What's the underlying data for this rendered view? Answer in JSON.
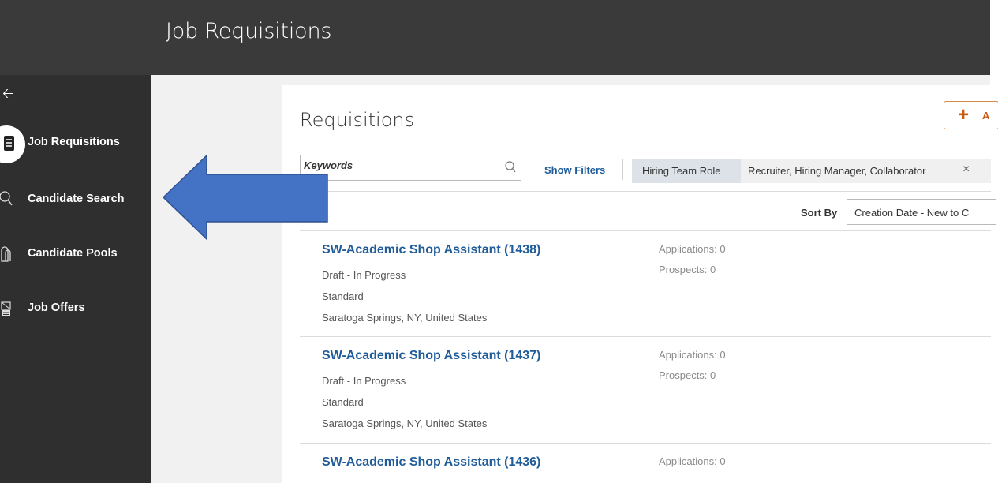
{
  "header": {
    "title": "Job Requisitions"
  },
  "sidebar": {
    "items": [
      {
        "label": "Job Requisitions",
        "icon": "document-list-icon",
        "active": true
      },
      {
        "label": "Candidate Search",
        "icon": "search-icon"
      },
      {
        "label": "Candidate Pools",
        "icon": "pool-icon"
      },
      {
        "label": "Job Offers",
        "icon": "offer-letter-icon"
      }
    ]
  },
  "main": {
    "title": "Requisitions",
    "add_button_label": "A",
    "search": {
      "placeholder": "Keywords"
    },
    "show_filters": "Show Filters",
    "filter": {
      "role": "Hiring Team Role",
      "values": "Recruiter, Hiring Manager, Collaborator",
      "remove": "×"
    },
    "sort": {
      "label": "Sort By",
      "value": "Creation Date - New to C"
    },
    "requisitions": [
      {
        "title": "SW-Academic Shop Assistant (1438)",
        "status": "Draft - In Progress",
        "type": "Standard",
        "location": "Saratoga Springs, NY, United States",
        "applications": "Applications: 0",
        "prospects": "Prospects: 0"
      },
      {
        "title": "SW-Academic Shop Assistant (1437)",
        "status": "Draft - In Progress",
        "type": "Standard",
        "location": "Saratoga Springs, NY, United States",
        "applications": "Applications: 0",
        "prospects": "Prospects: 0"
      },
      {
        "title": "SW-Academic Shop Assistant (1436)",
        "status": "",
        "type": "",
        "location": "",
        "applications": "Applications: 0",
        "prospects": ""
      }
    ]
  },
  "colors": {
    "topbar": "#3a3a3a",
    "sidebar": "#2f2f2f",
    "link": "#1f5c99",
    "accent": "#c95a0f",
    "annotation_arrow": "#4472c4"
  }
}
